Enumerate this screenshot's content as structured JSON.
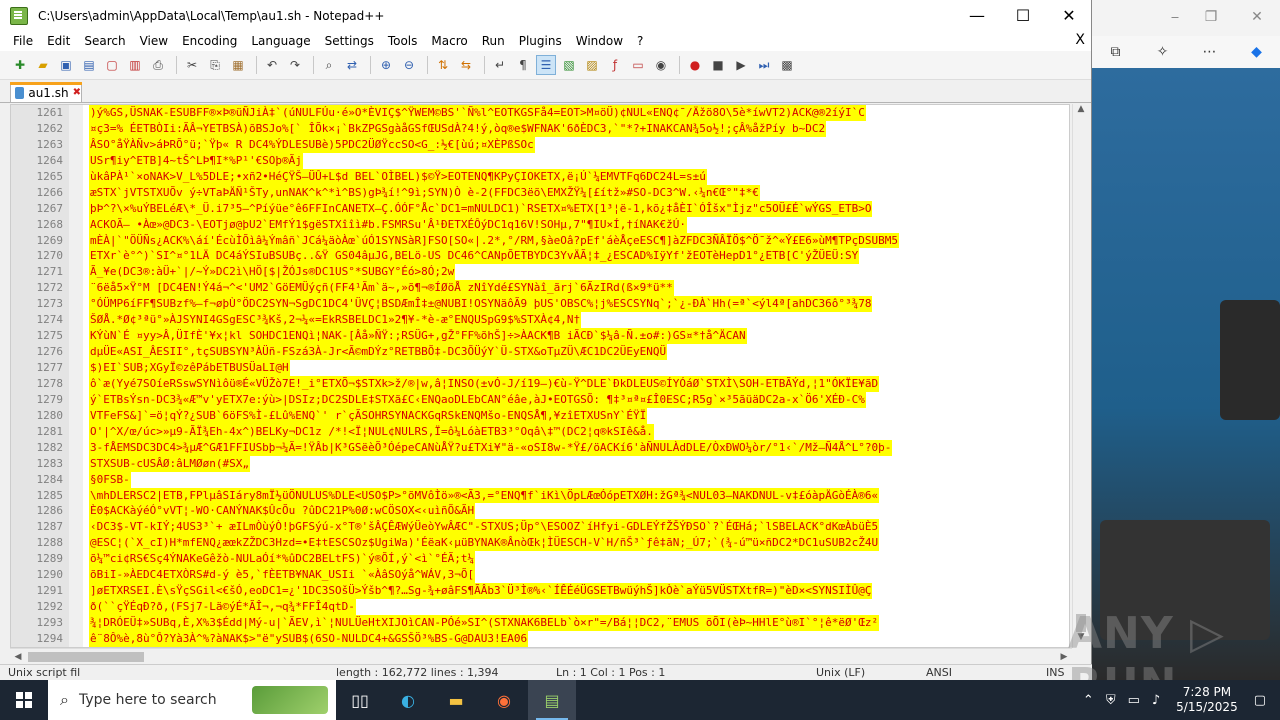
{
  "window": {
    "title": "C:\\Users\\admin\\AppData\\Local\\Temp\\au1.sh - Notepad++",
    "minimize": "—",
    "maximize": "☐",
    "close": "✕"
  },
  "menu": [
    "File",
    "Edit",
    "Search",
    "View",
    "Encoding",
    "Language",
    "Settings",
    "Tools",
    "Macro",
    "Run",
    "Plugins",
    "Window",
    "?"
  ],
  "menu_close": "X",
  "tab": {
    "label": "au1.sh",
    "close": "✖"
  },
  "editor": {
    "lines": [
      {
        "n": "1261",
        "t": ")ý%GS‚ÜSNAK-ESUBFF®×Þ®üÑJiÀ‡`(úNULFÚu·é»O*ÈVIÇ$^ŸWEM©BS'`Ñ%l^EOTKGSFå4=EOT>M¤öÜ)¢NUL«ENQ¢¯/Äžö8O\\5è*íwVT2)ACK@®2íýI`C"
      },
      {
        "n": "1262",
        "t": "¤ç3=% ÉETBÒIi:ÃÂ¬YETBSÀ)õBSJo%[` ÎÕk×¡`BkZPGSgàåGSfŒUSdÀ?4!ý,òq®e$WFNAK'6ðÈDC3,`\"*?+INAKCAN¾5o½!;çÂ%åžPíy b~DC2"
      },
      {
        "n": "1263",
        "t": "ÂSO°åŸÀÑv>áÞRÕ°ü;`Ÿþ«  R DC4%ÝDLESUBè)5PDC2ÜØŸccSO<G_:½€[ùú;¤XÈPßSOc"
      },
      {
        "n": "1264",
        "t": "USr¶iy^ETB]4~tŠ^LÞ¶I*%P¹'€SOþ®Ãj"
      },
      {
        "n": "1265",
        "t": "ùkâPÀ¹`×oNAK>V_L%5DLE;•xñ2•HéÇŸŠ–ÜÛ+L$d BEL`OÌBEL)$©Ÿ>EOTENQ¶KPyÇIOKETX,ë¡Ú`¼EMVTFq6DC24L=s±ú"
      },
      {
        "n": "1266",
        "t": "æSTX`jVTSTXUÕv ý÷VTaÞÄÑ¹ŠTy,unNAK^k^*ì^BS)gÞ¾í!^9ì;SYN)Ò è-2(FFDC3ëõ\\EMXŽŸ¼[£ítž»#SO-DC3^W.‹¼n€Œ°\"‡*€"
      },
      {
        "n": "1267",
        "t": "þÞ^?\\×%uÝBELéÆ\\*_Ü.i7³5–^Píýüe°ê6FFInCANETX—Ç.ÓÓF°Åc`DC1=mNULDC1)`RSETX¤%ETX[1³¦ë-1,kõ¿‡åÈI`ÓÎšx\"Ìjz\"c5OÜ£É`wÝGS_ETB>O"
      },
      {
        "n": "1268",
        "t": "ACKOÃ– •Àœ»@DC3-\\EOTjø@þU2`EMfÝ1$gëSTXîîì#b.FSMRSu'Â¹ÐETXÉÔýDC1q16V!SOHµ,7\"¶IU×Í,†íNAK€žÚ·"
      },
      {
        "n": "1269",
        "t": "mÈÀ|`\"ÖÜÑs¿ACK%\\áí'ÉcùÌÕìâ¼Ýmâñ`JCá¼äòÀœ`úÓ1SYNSàR]FSO[SO«|.2*,°/RM,§àeOâ?pEf'áèÅçeESC¶]àZFDC3ÑÂÏÖ$^Ö¯ž^«Ý£E6»ùM¶TPçDSUBM5"
      },
      {
        "n": "1270",
        "t": "ETXr`è°^)`SI^¤°1LÄ DC4áÝSIuBSUBç..&Ÿ   GS04âµJG,BELö-US DC46^CANpÕETBYDC3YvÄÃ¦‡_¿ESCAD%IÿYf'žEOTèHepD1°¿ETB[C'ýŽÜEÜ:SY"
      },
      {
        "n": "1271",
        "t": "Ã_¥e(DC3®:àÜ+`|/~Ý»DC2ì\\HÖ[$|ŽÓJs®DC1US°*SUBGY°Éó>8Ó;2w"
      },
      {
        "n": "1272",
        "t": "¨6ëå5×Ÿ°M  [DC4EN!Ý4á¬^<'UM2`GöEMÜýçñ(FF4¹Ãm`ä~,»õ¶¬®ÍØöÅ zNîYdé£SYNàî_ãrj`6ÃzIRd(ß×9*ü**"
      },
      {
        "n": "1273",
        "t": "°ÓÜMP6íFF¶SUBzf%—f¬øþÙ°ÖDC2SYN¬SgDC1DC4'ÜVÇ¦BSDÆmÎ‡±@NUBI!OSYNäôÃ9 þUS'OBSC%¦j%ESCSYNq`;`¿-ÐÀ`Hh(=ª`<ýl4ª[ahDC36ô°³¾78"
      },
      {
        "n": "1274",
        "t": "ŠØÅ.*Ø¢³ªü°»ÀJSYNI4GSgESC³¾Kš,2¬¼«=EkRSBELDC1»2¶¥-*è-æ°ENQUSpG9$%STXÀ¢4,N†"
      },
      {
        "n": "1275",
        "t": "KÝùN`É ¤yy>Â,ÜIfÈ'¥x¦kl SOHDC1ENQì¦NAK-[Âå»ÑŸ:;RSÜG+,gŽ°FF%õhŠ]÷>ÀACK¶B iÃCÐ`$¼â-Ñ.±o#:)GS¤*†å^ÄCAN"
      },
      {
        "n": "1276",
        "t": "dµÜE«ASI_ÂESII°,tçSUBSYN³ÀÜñ-FSzá3À-Jr<Ã©mDÝz°RETBBÕ‡-DC3ÕÜýY`Ü-STX&oTµZÜ\\ÆC1DC2ÜEyENQÜ"
      },
      {
        "n": "1277",
        "t": "$)EI`SUB;XGyÏ©zêPábETBUSÜaLI@H"
      },
      {
        "n": "1278",
        "t": "ô`æ(Yyé7SOíeRSswSYNìôü®É«VÜŽò7E!_i°ETXÕ¬$STXk>ž/®|w,â¦INSO(±vÓ-J/í19—)€ù-Ÿ^DLE`ÐkDLEUS©ÍYÓáØ`STXÌ\\SOH-ETBÃÝd,¦1\"ÓKÏE¥ãD"
      },
      {
        "n": "1279",
        "t": "ý`ETBsÝsn-DC3¾«Æ™v'yETX7e:ýù>|DSIz;DC2SDLE‡STXã£C‹ENQaoDLEbCAN°éâe,àJ•EOTGSÕ: ¶‡³¤ª¤£Î0ESC;R5g`×³5ãüäDC2a-x`Ö6'XÉÐ-C%"
      },
      {
        "n": "1280",
        "t": "VTFeFS&]`=ö¦qÝ?¿SUB`6öFS%Ì-£Lû%ENQ`' r`çÃSOHRSYNACKGqRSkENQMšo-ENQSÅ¶,¥zîETXUSnY`ÉŸÏ"
      },
      {
        "n": "1281",
        "t": "O'|^X/œ/úc>»µ9-ÃÏ¾Eh-4x^)BELKy¬DC1z    /*!<Ï¦NUL¢NULRS,Ï=ô¼LóàETB3³°Oqâ\\‡™(DC2¦q®kSIê&å."
      },
      {
        "n": "1282",
        "t": "3-fÅEMSDC3DC4>¾µÆ^GÆ1FFIUSbþ¬¼Ã=!ŸÂb|K³GSëèÕ³ÓépeCANùÅŸ?u£TXi¥\"ä-«oSI8w-*Ÿ£/öACKí6'àÑNULÀdDLE/ÒxÐWO¼òr/°1‹`/Mž—Ñ4Å^L°?0þ-"
      },
      {
        "n": "1283",
        "t": "STXSUB-cUSÂØ:âLMØøn(#SX„"
      },
      {
        "n": "1284",
        "t": "§0FSB-"
      },
      {
        "n": "1285",
        "t": "\\mhDLERSC2|ETB,FPlµâSIáry8mÏ½üÖNULUS%DLE<USO$P>°õMVôÌö»®<Ã3,=°ENQ¶f`iKì\\ÖpLÆœÓópETXØH:žGª¾<NUL03—NAKDNUL-v‡£óàpÄGòÉÀ®6«"
      },
      {
        "n": "1286",
        "t": "È0$ACKàýéÓ°vVT¦-WO·CANÝNAK$ÛcÕu ?ûDC21P%0Ø:wCÖSOX<‹uìñÕ&ÃH"
      },
      {
        "n": "1287",
        "t": "‹DC3$-VT-kIÝ;4US3³`+ æILmÒùýÒ!þGFSýú-x°T®'šÂÇÊÆWýÜeòYwÂÆC\"-STXUS;Üp°\\ESOOZ`íHfyi-GDLEÝfŽŠÝÐSO`?`ÉŒHá;`lSBELACK°dKœÀbüÈ5"
      },
      {
        "n": "1288",
        "t": "@ESC¦(`X_cI)H*mfENQ¿æœkZŽDC3Hzd=•E‡tESCSOz$UgiWa)'ÉëaK‹µüBYNAK®ÂnòŒk¦ÌÜESCH-V`H/ñŠ³`ƒê‡ãN;_Ú7;`(¾-ú™ü×ñDC2*DC1uSUB2cŽ4U"
      },
      {
        "n": "1289",
        "t": "õ¼™ci¢RS€Sç4ÝNAKeGêžò-NULaÓí*%ûDC2BELtFS)`ý®ÕÍ,ý`<ì`°ÉÃ;t¼"
      },
      {
        "n": "1290",
        "t": "õBiI-»ÀEDC4ETXÒRS#d-ý  è5,`fÈETB¥NAK_USIi `«ÀâSOýå^WÁV,3¬Õ["
      },
      {
        "n": "1291",
        "t": "]øETXRSEI.È\\sŸçSGil<€šÓ,eoDC1=¿'1DC3SOšÜ>Ýšb^¶?…Sg-¾+øâFS¶ÃÂb3`Ü³Ì®%‹`ÍÊÉéÜGSETBwüýhŠ]kÒè`aÝü5VÜSTXtfR=)\"èD×<SYNSIÌÛ@Ç"
      },
      {
        "n": "1292",
        "t": "ð(``çŸÉqÐ?ð,(FSj7-Lä©ýÉ*ÃÎ¬,¬q¾*FFÎ4qtD-"
      },
      {
        "n": "1293",
        "t": "¾¦DRÓEÜ‡»SUBq,È,X%3$Édd|Mý-u|`ÃEV,ì`¦NULÜeHtXIJOìCAN-PÓé»SI^(STXNAK6BELb`ò×r\"=/Bá¦¦DC2,¨EMUS õÕI(èÞ~HHlE°ù®I`°¦ê*ëØ'Œz²"
      },
      {
        "n": "1294",
        "t": "ê¨8Ô%è,8ù°Ô?Yà3À^%?àNAK$>\"ë\"ySUB$(6SO-NULDC4+&GSŠÖ³%BS-G@DAU3!EA06"
      }
    ]
  },
  "statusbar": {
    "type": "Unix script fil",
    "length": "length : 162,772   lines : 1,394",
    "pos": "Ln : 1    Col : 1    Pos : 1",
    "eol": "Unix (LF)",
    "encoding": "ANSI",
    "mode": "INS"
  },
  "watermark": "ANY ▷ RUN",
  "taskbar": {
    "search_placeholder": "Type here to search",
    "time": "7:28 PM",
    "date": "5/15/2025"
  },
  "edge": {
    "minimize": "⎯",
    "restore": "❐",
    "close": "✕"
  },
  "icons": {
    "windows": "windows-icon",
    "search": "search-icon",
    "taskview": "task-view-icon",
    "edge": "edge-icon",
    "explorer": "folder-icon",
    "firefox": "firefox-icon",
    "notepadpp": "notepadpp-icon"
  }
}
